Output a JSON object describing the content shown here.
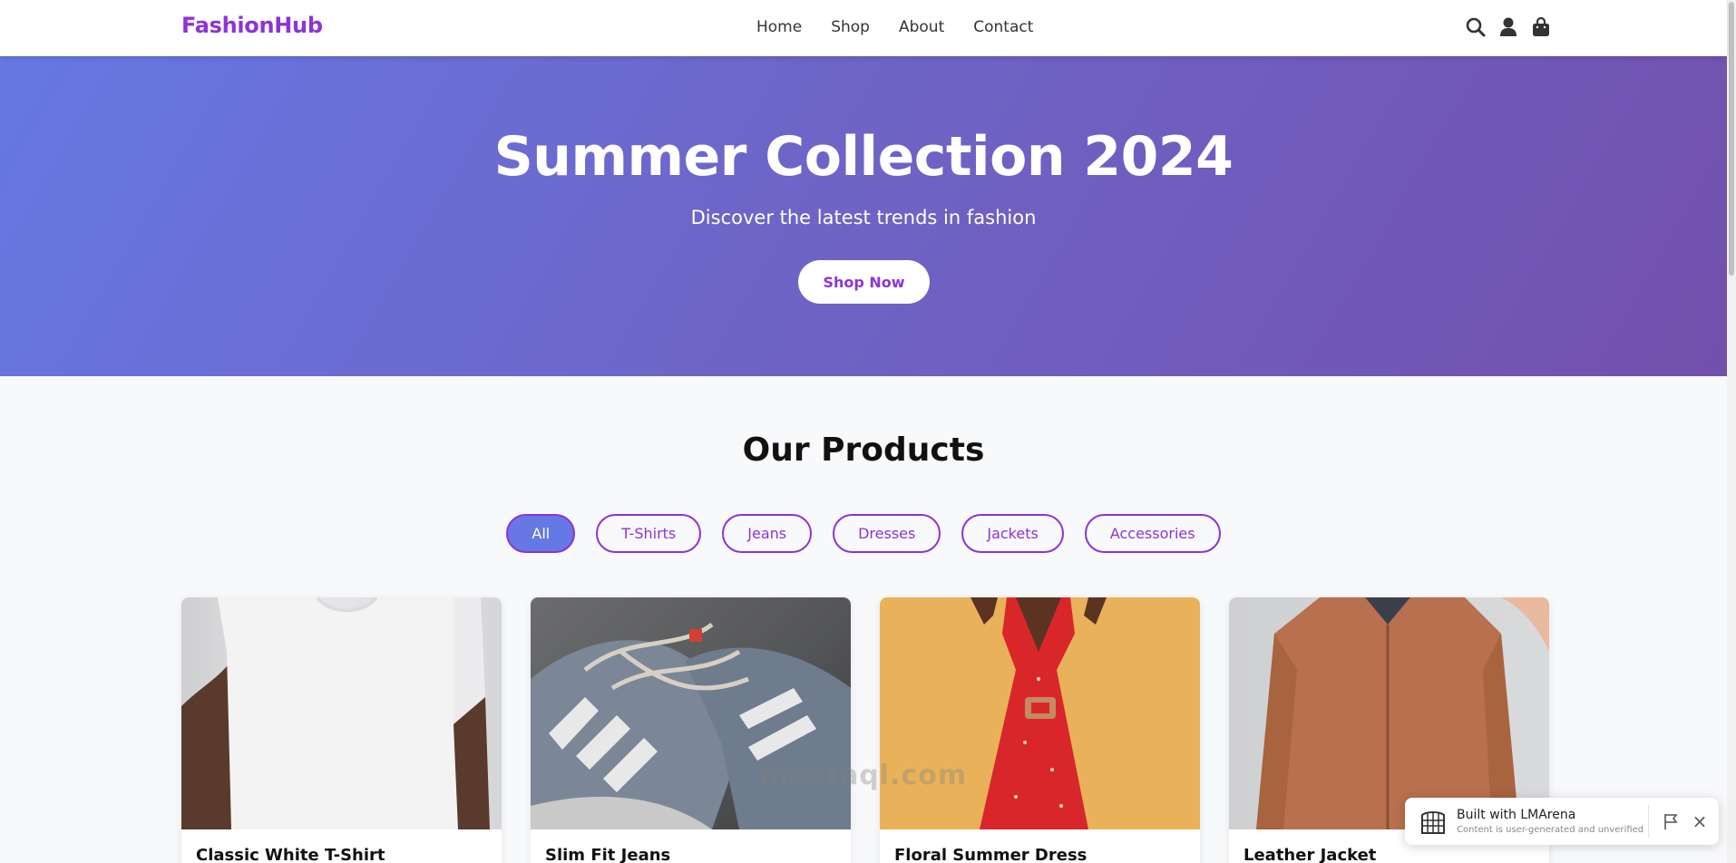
{
  "header": {
    "logo": "FashionHub",
    "nav": [
      "Home",
      "Shop",
      "About",
      "Contact"
    ],
    "icons": [
      "search-icon",
      "user-icon",
      "shopping-bag-icon"
    ]
  },
  "hero": {
    "title": "Summer Collection 2024",
    "subtitle": "Discover the latest trends in fashion",
    "cta": "Shop Now"
  },
  "products": {
    "title": "Our Products",
    "filters": [
      "All",
      "T-Shirts",
      "Jeans",
      "Dresses",
      "Jackets",
      "Accessories"
    ],
    "active_filter": "All",
    "items": [
      {
        "name": "Classic White T-Shirt"
      },
      {
        "name": "Slim Fit Jeans"
      },
      {
        "name": "Floral Summer Dress"
      },
      {
        "name": "Leather Jacket"
      }
    ]
  },
  "watermark": "mostaql.com",
  "badge": {
    "title": "Built with LMArena",
    "subtitle": "Content is user-generated and unverified"
  },
  "colors": {
    "brand": "#8e33d6",
    "hero_start": "#6678e3",
    "hero_end": "#7350ad",
    "active_filter": "#6678e3"
  }
}
